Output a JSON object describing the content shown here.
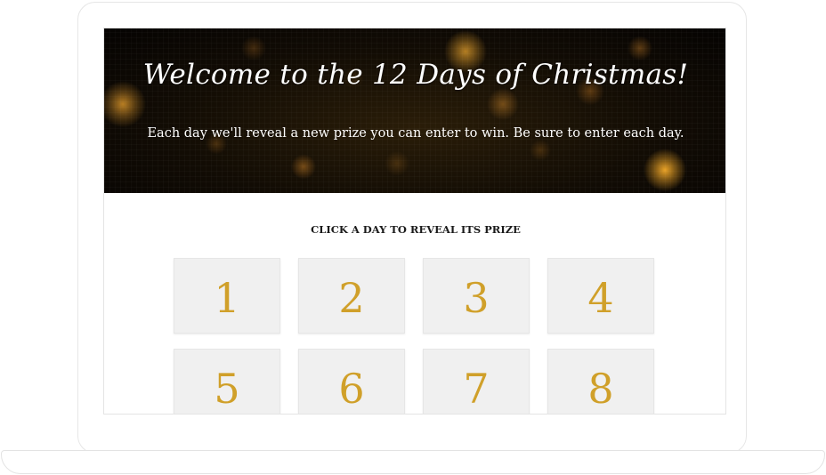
{
  "header": {
    "title": "Welcome to the 12 Days of Christmas!",
    "subtitle": "Each day we'll reveal a new prize you can enter to win. Be sure to enter each day."
  },
  "main": {
    "instruction": "CLICK A DAY TO REVEAL ITS PRIZE",
    "days": [
      {
        "label": "1"
      },
      {
        "label": "2"
      },
      {
        "label": "3"
      },
      {
        "label": "4"
      },
      {
        "label": "5"
      },
      {
        "label": "6"
      },
      {
        "label": "7"
      },
      {
        "label": "8"
      }
    ]
  },
  "colors": {
    "accent_gold": "#d0a02a",
    "tile_background": "#f0f0f0",
    "hero_background": "#120c04"
  }
}
